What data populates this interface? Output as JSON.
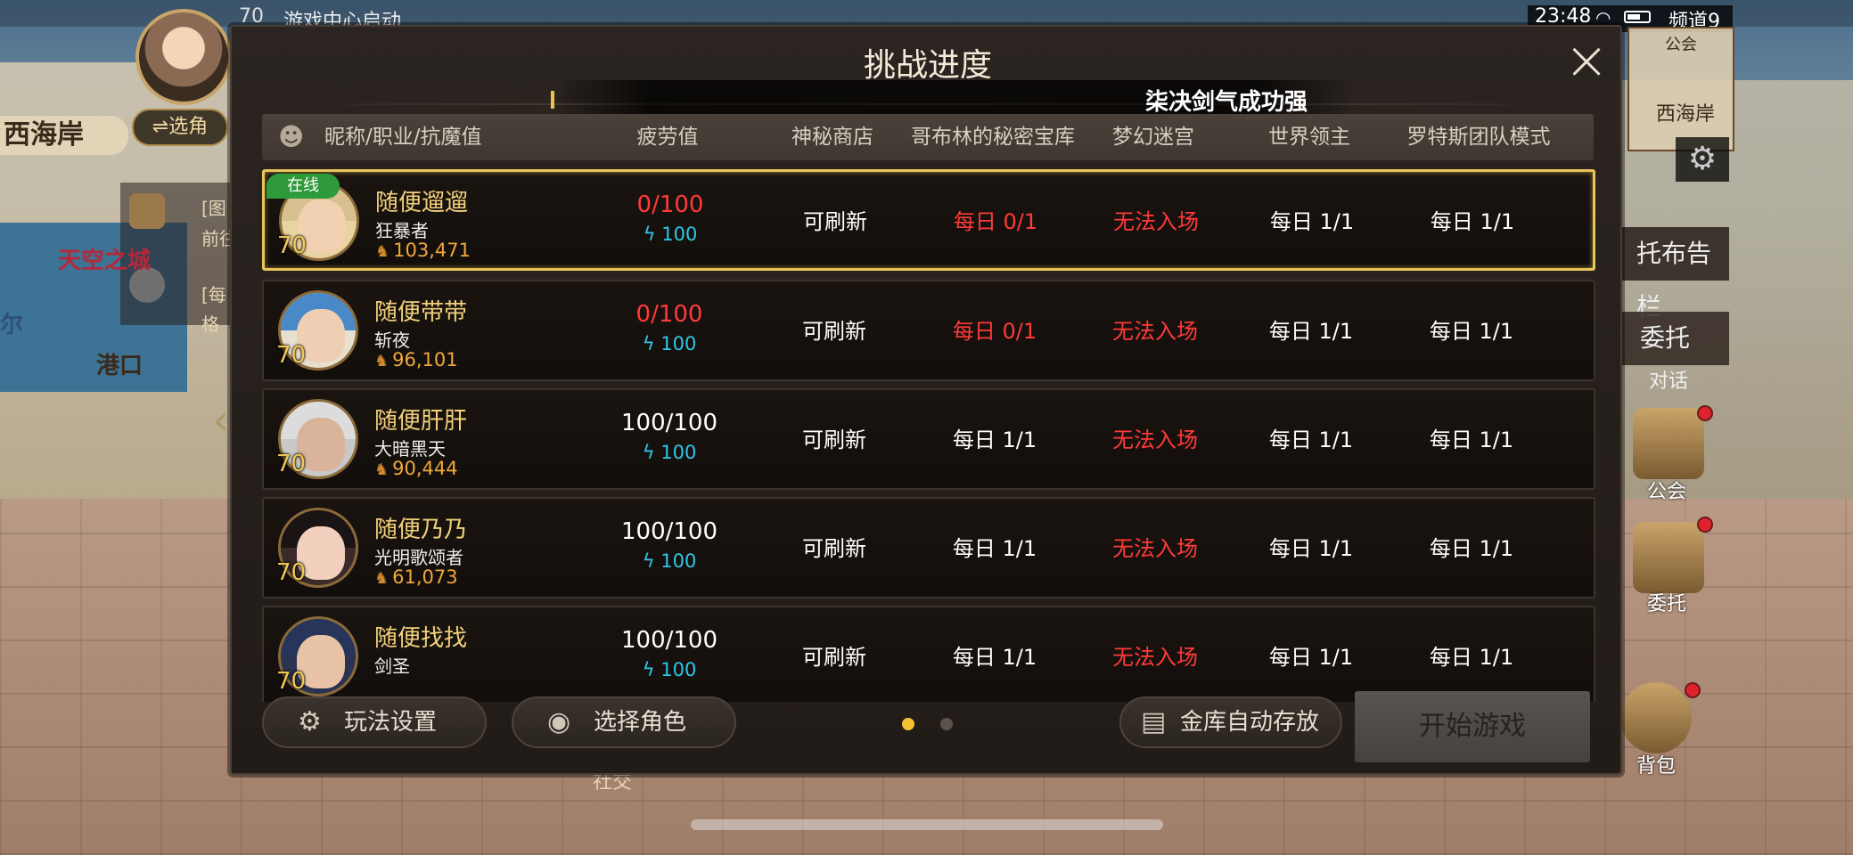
{
  "hud": {
    "level_top": "70",
    "game_center": "游戏中心启动",
    "location": "西海岸",
    "select_role": "⇌选角",
    "quests": [
      "[图",
      "前往",
      "[每",
      "格"
    ],
    "map_sky": "天空之城",
    "map_port": "港口",
    "map_er": "尔"
  },
  "status": {
    "time": "23:48",
    "channel": "频道9",
    "minimap_title": "西海岸",
    "minimap_guild": "公会"
  },
  "side": {
    "board": "托布告栏",
    "quest": "委托",
    "dialog": "对话",
    "guild": "公会",
    "commission": "委托",
    "bag": "背包",
    "social": "社交"
  },
  "dialog": {
    "title": "挑战进度",
    "marquee": "柒决剑气成功强",
    "headers": {
      "name": "昵称/职业/抗魔值",
      "fatigue": "疲劳值",
      "shop": "神秘商店",
      "goblin": "哥布林的秘密宝库",
      "dream": "梦幻迷宫",
      "lord": "世界领主",
      "raid": "罗特斯团队模式"
    },
    "online_label": "在线",
    "rows": [
      {
        "name": "随便遛遛",
        "job": "狂暴者",
        "power": "103,471",
        "level": "70",
        "fatigue": "0/100",
        "energy": "100",
        "shop": "可刷新",
        "goblin": "每日 0/1",
        "dream": "无法入场",
        "lord": "每日 1/1",
        "raid": "每日 1/1"
      },
      {
        "name": "随便带带",
        "job": "斩夜",
        "power": "96,101",
        "level": "70",
        "fatigue": "0/100",
        "energy": "100",
        "shop": "可刷新",
        "goblin": "每日 0/1",
        "dream": "无法入场",
        "lord": "每日 1/1",
        "raid": "每日 1/1"
      },
      {
        "name": "随便肝肝",
        "job": "大暗黑天",
        "power": "90,444",
        "level": "70",
        "fatigue": "100/100",
        "energy": "100",
        "shop": "可刷新",
        "goblin": "每日 1/1",
        "dream": "无法入场",
        "lord": "每日 1/1",
        "raid": "每日 1/1"
      },
      {
        "name": "随便乃乃",
        "job": "光明歌颂者",
        "power": "61,073",
        "level": "70",
        "fatigue": "100/100",
        "energy": "100",
        "shop": "可刷新",
        "goblin": "每日 1/1",
        "dream": "无法入场",
        "lord": "每日 1/1",
        "raid": "每日 1/1"
      },
      {
        "name": "随便找找",
        "job": "剑圣",
        "power": "",
        "level": "70",
        "fatigue": "100/100",
        "energy": "100",
        "shop": "可刷新",
        "goblin": "每日 1/1",
        "dream": "无法入场",
        "lord": "每日 1/1",
        "raid": "每日 1/1"
      }
    ],
    "buttons": {
      "settings": "玩法设置",
      "select": "选择角色",
      "auto_store": "金库自动存放",
      "start": "开始游戏"
    }
  },
  "colors": {
    "accent_gold": "#e9c45a",
    "warn_red": "#ff3a3a",
    "energy_cyan": "#2fc7e8",
    "online_green": "#2f9a3a"
  }
}
